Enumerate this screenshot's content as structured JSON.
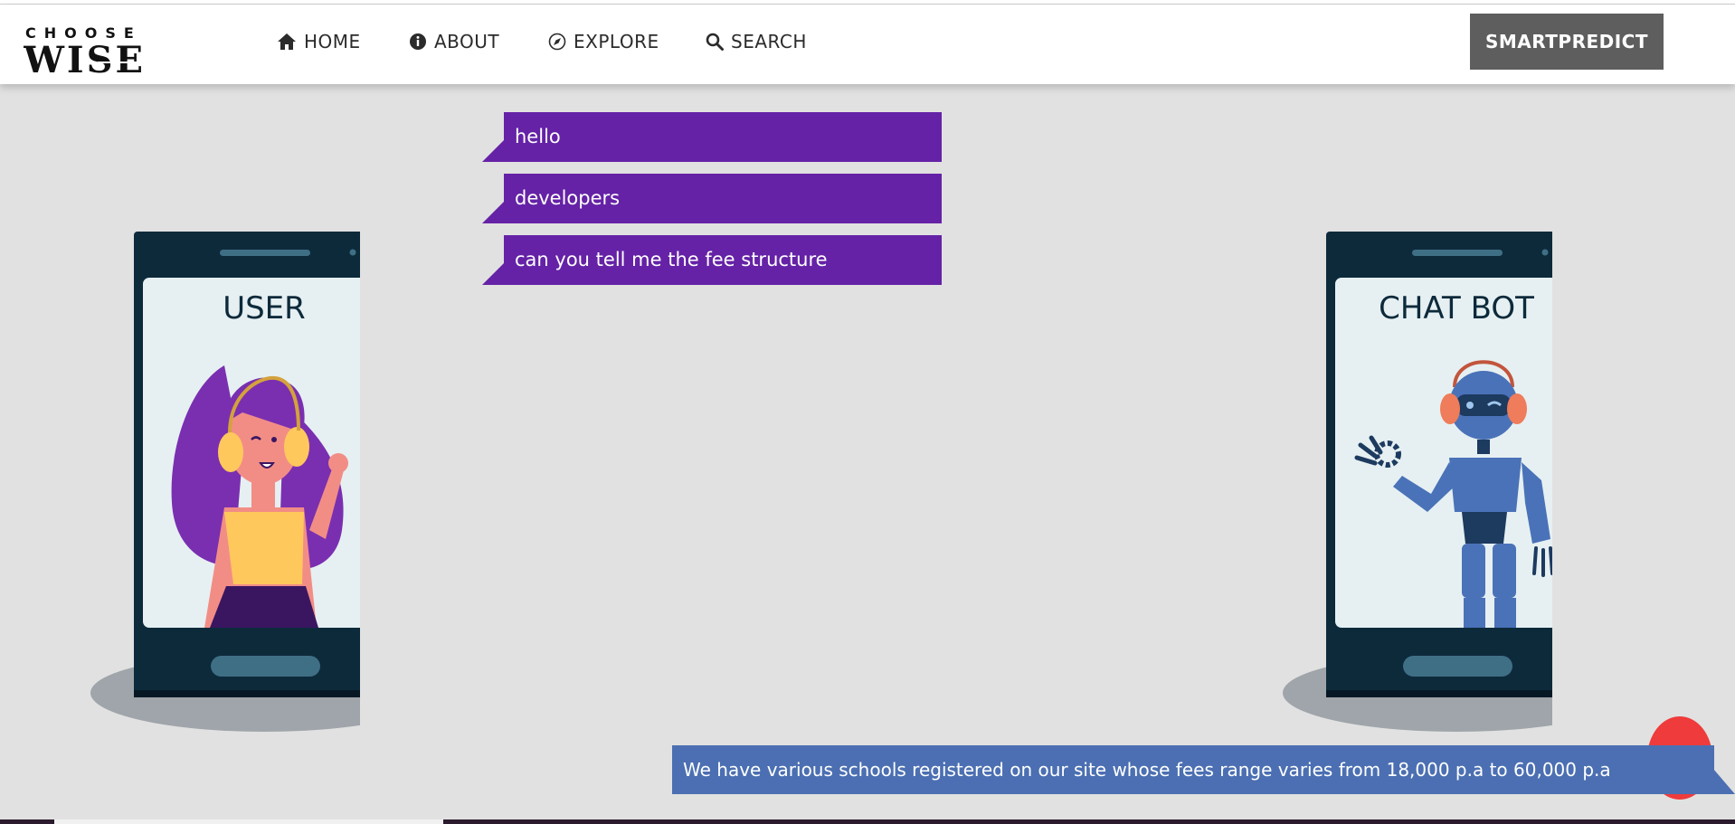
{
  "nav": {
    "logo_top": "CHOOSE",
    "logo_bottom": "WISE",
    "items": [
      {
        "label": "HOME",
        "icon": "home-icon"
      },
      {
        "label": "ABOUT",
        "icon": "info-icon"
      },
      {
        "label": "EXPLORE",
        "icon": "compass-icon"
      },
      {
        "label": "SEARCH",
        "icon": "search-icon"
      }
    ],
    "cta_label": "SMARTPREDICT"
  },
  "chat": {
    "user_messages": [
      "hello",
      "developers",
      "can you tell me the fee structure"
    ],
    "bot_reply": "We have various schools registered on our site whose fees range varies from 18,000 p.a to 60,000 p.a"
  },
  "phones": {
    "user_label": "USER",
    "bot_label": "CHAT BOT"
  },
  "colors": {
    "user_bubble": "#6522a6",
    "bot_bubble": "#4b6fb2",
    "cta": "#5e5e5e",
    "help_button": "#ef3b3b",
    "page_background": "#e1e1e1"
  }
}
